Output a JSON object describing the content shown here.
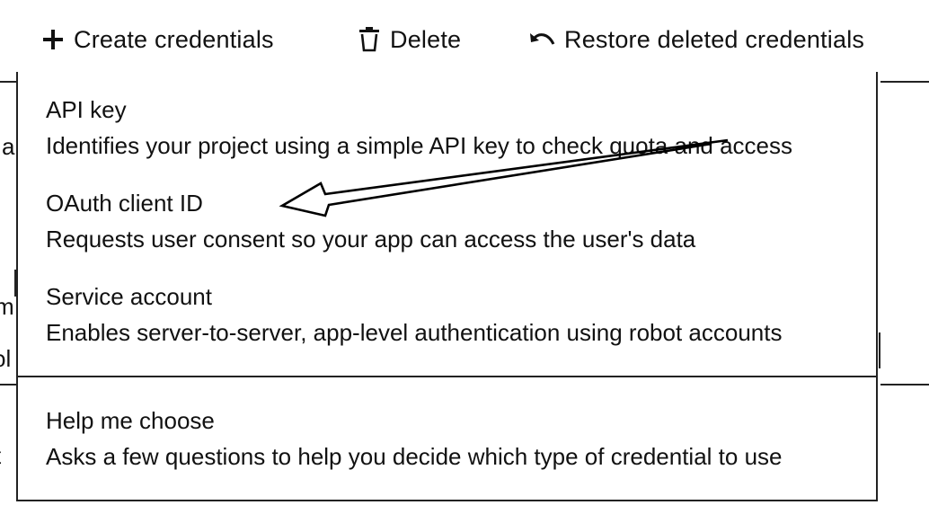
{
  "toolbar": {
    "create_label": "Create credentials",
    "delete_label": "Delete",
    "restore_label": "Restore deleted credentials"
  },
  "menu": {
    "items": [
      {
        "title": "API key",
        "description": "Identifies your project using a simple API key to check quota and access"
      },
      {
        "title": "OAuth client ID",
        "description": "Requests user consent so your app can access the user's data"
      },
      {
        "title": "Service account",
        "description": "Enables server-to-server, app-level authentication using robot accounts"
      },
      {
        "title": "Help me choose",
        "description": "Asks a few questions to help you decide which type of credential to use"
      }
    ]
  },
  "background_fragments": [
    "a",
    "m",
    "ol",
    "t"
  ],
  "icons": {
    "create": "plus-icon",
    "delete": "trash-icon",
    "restore": "undo-icon",
    "annotation": "hand-drawn-arrow"
  }
}
